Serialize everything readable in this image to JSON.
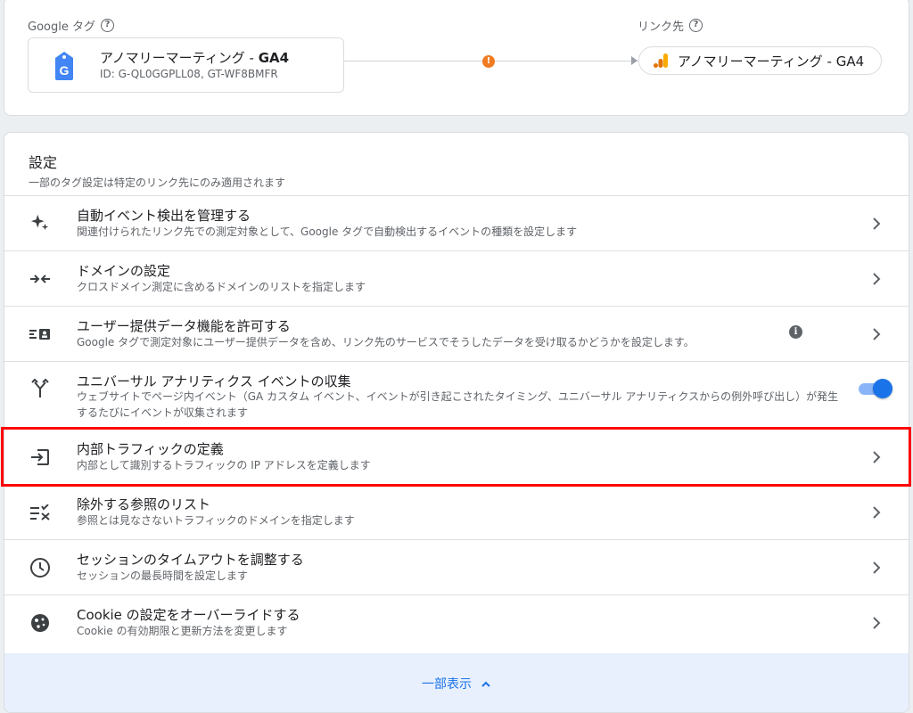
{
  "top": {
    "tag_label": "Google タグ",
    "dest_label": "リンク先",
    "tag_name_plain": "アノマリーマーティング - ",
    "tag_name_bold": "GA4",
    "tag_id": "ID: G-QL0GGPLL08, GT-WF8BMFR",
    "dest_name": "アノマリーマーティング - GA4",
    "warning_icon": "warning-dot"
  },
  "settings": {
    "title": "設定",
    "subtitle": "一部のタグ設定は特定のリンク先にのみ適用されます",
    "rows": [
      {
        "icon": "sparkle-icon",
        "title": "自動イベント検出を管理する",
        "desc": "関連付けられたリンク先での測定対象として、Google タグで自動検出するイベントの種類を設定します"
      },
      {
        "icon": "merge-arrows-icon",
        "title": "ドメインの設定",
        "desc": "クロスドメイン測定に含めるドメインのリストを指定します"
      },
      {
        "icon": "user-data-icon",
        "title": "ユーザー提供データ機能を許可する",
        "desc": "Google タグで測定対象にユーザー提供データを含め、リンク先のサービスでそうしたデータを受け取るかどうかを設定します。"
      },
      {
        "icon": "fork-icon",
        "title": "ユニバーサル アナリティクス イベントの収集",
        "desc": "ウェブサイトでページ内イベント（GA カスタム イベント、イベントが引き起こされたタイミング、ユニバーサル アナリティクスからの例外呼び出し）が発生するたびにイベントが収集されます",
        "toggle_on": true
      },
      {
        "icon": "login-arrow-icon",
        "title": "内部トラフィックの定義",
        "desc": "内部として識別するトラフィックの IP アドレスを定義します"
      },
      {
        "icon": "list-remove-icon",
        "title": "除外する参照のリスト",
        "desc": "参照とは見なさないトラフィックのドメインを指定します"
      },
      {
        "icon": "clock-icon",
        "title": "セッションのタイムアウトを調整する",
        "desc": "セッションの最長時間を設定します"
      },
      {
        "icon": "cookie-icon",
        "title": "Cookie の設定をオーバーライドする",
        "desc": "Cookie の有効期限と更新方法を変更します"
      }
    ],
    "footer_label": "一部表示"
  },
  "colors": {
    "accent": "#1a73e8",
    "highlight": "#ff0000",
    "warning": "#f07b22",
    "analytics_orange": "#f9ab00"
  }
}
